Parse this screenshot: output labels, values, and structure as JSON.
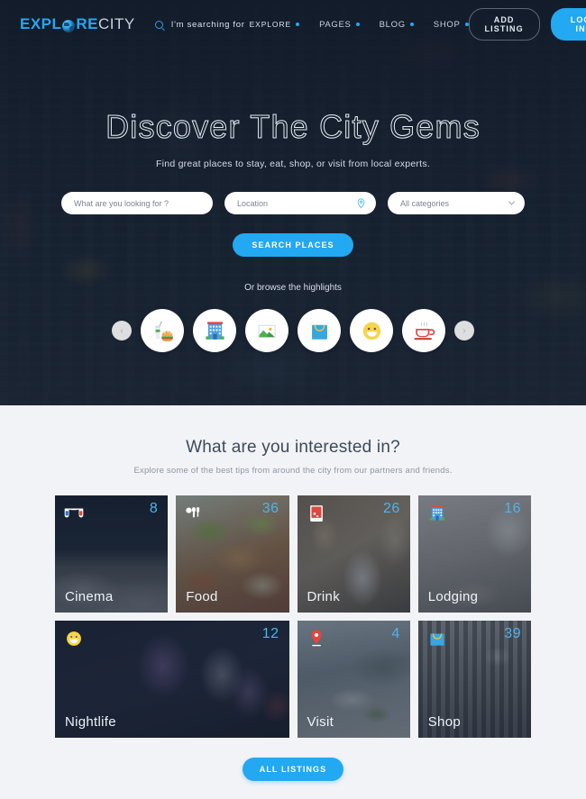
{
  "brand": {
    "name_part1": "EXPL",
    "name_part2": "RE",
    "name_part3": "CITY",
    "globe_icon": "globe-icon"
  },
  "colors": {
    "accent": "#23a8f2",
    "count_blue": "#4fb3ef",
    "hero_bg": "#16202e",
    "section_bg": "#f1f3f6"
  },
  "nav": {
    "search_prefix": "I'm searching for",
    "search_keyword": "EXPLORE",
    "items": [
      {
        "label": "PAGES"
      },
      {
        "label": "BLOG"
      },
      {
        "label": "SHOP"
      }
    ],
    "add_listing": "ADD LISTING",
    "log_in": "LOG IN"
  },
  "hero": {
    "title": "Discover The City Gems",
    "subtitle": "Find great places to stay, eat, shop, or visit from local experts.",
    "search": {
      "keyword_placeholder": "What are you looking for ?",
      "keyword_value": "",
      "location_placeholder": "Location",
      "location_value": "",
      "category_selected": "All categories",
      "category_options": [
        "All categories"
      ],
      "button_label": "SEARCH PLACES"
    },
    "browse_label": "Or browse the highlights",
    "carousel": {
      "prev_glyph": "‹",
      "next_glyph": "›",
      "items": [
        {
          "icon": "food-burger-drink-icon"
        },
        {
          "icon": "hotel-building-icon"
        },
        {
          "icon": "photo-image-icon"
        },
        {
          "icon": "shopping-bag-icon"
        },
        {
          "icon": "smiley-face-icon"
        },
        {
          "icon": "coffee-cup-icon"
        }
      ]
    }
  },
  "interest": {
    "title": "What are you interested in?",
    "subtitle": "Explore some of the best tips from around the city from our partners and friends.",
    "cards": [
      {
        "label": "Cinema",
        "count": "8",
        "icon": "3d-glasses-icon",
        "bg": "bg-cinema",
        "wide": false
      },
      {
        "label": "Food",
        "count": "36",
        "icon": "cutlery-icon",
        "bg": "bg-food",
        "wide": false
      },
      {
        "label": "Drink",
        "count": "26",
        "icon": "drink-cup-icon",
        "bg": "bg-drink",
        "wide": false
      },
      {
        "label": "Lodging",
        "count": "16",
        "icon": "hotel-building-icon",
        "bg": "bg-lodging",
        "wide": false
      },
      {
        "label": "Nightlife",
        "count": "12",
        "icon": "smiley-face-icon",
        "bg": "bg-nightlife",
        "wide": true
      },
      {
        "label": "Visit",
        "count": "4",
        "icon": "map-pin-icon",
        "bg": "bg-visit",
        "wide": false
      },
      {
        "label": "Shop",
        "count": "39",
        "icon": "shopping-bag-icon",
        "bg": "bg-shop",
        "wide": false
      }
    ],
    "all_listings_label": "ALL LISTINGS"
  }
}
